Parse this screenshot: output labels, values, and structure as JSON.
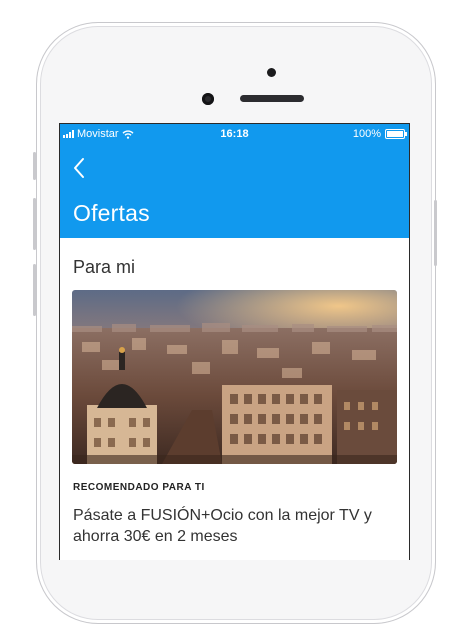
{
  "status_bar": {
    "carrier": "Movistar",
    "time": "16:18",
    "battery": "100%"
  },
  "header": {
    "title": "Ofertas",
    "back_icon": "chevron-left-icon"
  },
  "section": {
    "title": "Para mi"
  },
  "offer_card": {
    "tag": "RECOMENDADO PARA TI",
    "headline": "Pásate a FUSIÓN+Ocio con la mejor TV y ahorra 30€ en 2 meses"
  },
  "colors": {
    "header_bg": "#1199ee",
    "phone_frame": "#f6f6f7"
  }
}
